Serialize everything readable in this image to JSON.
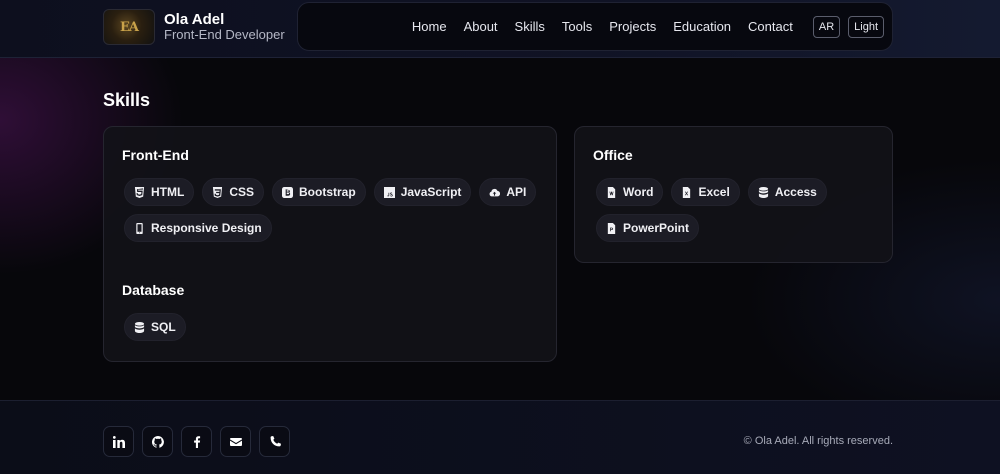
{
  "brand": {
    "name": "Ola Adel",
    "role": "Front-End Developer",
    "logo_text": "EA"
  },
  "nav": {
    "links": [
      "Home",
      "About",
      "Skills",
      "Tools",
      "Projects",
      "Education",
      "Contact"
    ],
    "lang_button": "AR",
    "theme_button": "Light"
  },
  "skills": {
    "title": "Skills",
    "frontend": {
      "title": "Front-End",
      "items": [
        {
          "label": "HTML",
          "icon": "html5-icon"
        },
        {
          "label": "CSS",
          "icon": "css3-icon"
        },
        {
          "label": "Bootstrap",
          "icon": "bootstrap-icon"
        },
        {
          "label": "JavaScript",
          "icon": "javascript-icon"
        },
        {
          "label": "API",
          "icon": "cloud-icon"
        },
        {
          "label": "Responsive Design",
          "icon": "mobile-icon"
        }
      ]
    },
    "database": {
      "title": "Database",
      "items": [
        {
          "label": "SQL",
          "icon": "database-icon"
        }
      ]
    },
    "office": {
      "title": "Office",
      "items": [
        {
          "label": "Word",
          "icon": "word-file-icon"
        },
        {
          "label": "Excel",
          "icon": "excel-file-icon"
        },
        {
          "label": "Access",
          "icon": "database-icon"
        },
        {
          "label": "PowerPoint",
          "icon": "powerpoint-file-icon"
        }
      ]
    }
  },
  "footer": {
    "socials": [
      "linkedin-icon",
      "github-icon",
      "facebook-icon",
      "email-icon",
      "phone-icon"
    ],
    "copyright": "© Ola Adel. All rights reserved."
  }
}
